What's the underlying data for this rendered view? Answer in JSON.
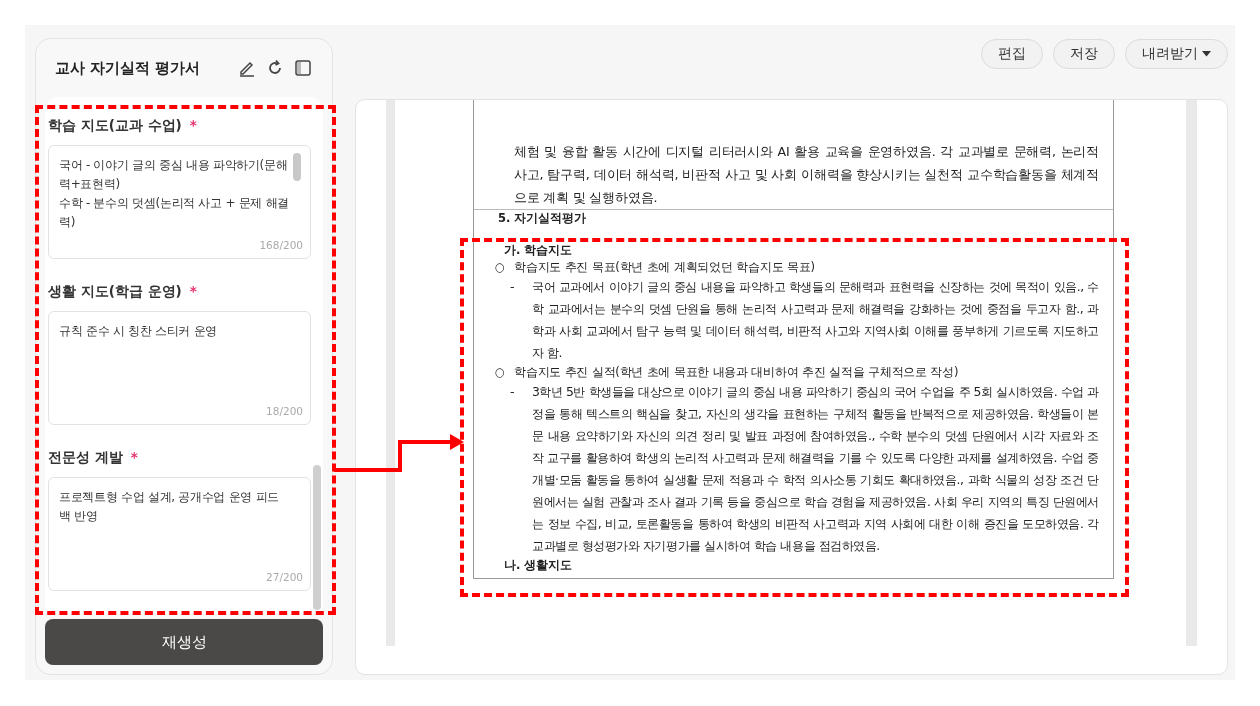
{
  "sidebar": {
    "title": "교사 자기실적 평가서",
    "fields": [
      {
        "label": "학습 지도(교과 수업)",
        "required_mark": "*",
        "value": "국어 - 이야기 글의 중심 내용 파악하기(문해력+표현력)\n수학 - 분수의 덧셈(논리적 사고 + 문제 해결력)",
        "count": "168/200",
        "scrollable": true
      },
      {
        "label": "생활 지도(학급 운영)",
        "required_mark": "*",
        "value": "규칙 준수 시 칭찬 스티커 운영",
        "count": "18/200",
        "scrollable": false
      },
      {
        "label": "전문성 계발",
        "required_mark": "*",
        "value": "프로젝트형 수업 설계, 공개수업 운영 피드백 반영",
        "count": "27/200",
        "scrollable": false
      }
    ],
    "regenerate_button": "재생성"
  },
  "toolbar": {
    "buttons": [
      {
        "label": "편집",
        "kind": "plain"
      },
      {
        "label": "저장",
        "kind": "plain"
      },
      {
        "label": "내려받기",
        "kind": "dropdown"
      }
    ]
  },
  "document": {
    "blocks": [
      {
        "kind": "continuation",
        "text": "체험 및 융합 활동 시간에 디지털 리터러시와 AI 활용 교육을 운영하였음. 각 교과별로 문해력, 논리적 사고, 탐구력, 데이터 해석력, 비판적 사고 및 사회 이해력을 향상시키는 실천적 교수학습활동을 체계적으로 계획 및 실행하였음."
      },
      {
        "kind": "section",
        "text": "5. 자기실적평가"
      },
      {
        "kind": "subheading",
        "text": "가. 학습지도"
      },
      {
        "kind": "bullet",
        "marker": "○",
        "text": "학습지도 추진 목표(학년 초에 계획되었던 학습지도 목표)"
      },
      {
        "kind": "dash",
        "marker": "-",
        "text": "국어 교과에서 이야기 글의 중심 내용을 파악하고 학생들의 문해력과 표현력을 신장하는 것에 목적이 있음., 수학 교과에서는 분수의 덧셈 단원을 통해 논리적 사고력과 문제 해결력을 강화하는 것에 중점을 두고자 함., 과학과 사회 교과에서 탐구 능력 및 데이터 해석력, 비판적 사고와 지역사회 이해를 풍부하게 기르도록 지도하고자 함."
      },
      {
        "kind": "bullet",
        "marker": "○",
        "text": "학습지도 추진 실적(학년 초에 목표한 내용과 대비하여 추진 실적을 구체적으로 작성)"
      },
      {
        "kind": "dash",
        "marker": "-",
        "text": "3학년 5반 학생들을 대상으로 이야기 글의 중심 내용 파악하기 중심의 국어 수업을 주 5회 실시하였음. 수업 과정을 통해 텍스트의 핵심을 찾고, 자신의 생각을 표현하는 구체적 활동을 반복적으로 제공하였음. 학생들이 본문 내용 요약하기와 자신의 의견 정리 및 발표 과정에 참여하였음., 수학 분수의 덧셈 단원에서 시각 자료와 조작 교구를 활용하여 학생의 논리적 사고력과 문제 해결력을 기를 수 있도록 다양한 과제를 설계하였음. 수업 중 개별·모둠 활동을 통하여 실생활 문제 적용과 수 학적 의사소통 기회도 확대하였음., 과학 식물의 성장 조건 단원에서는 실험 관찰과 조사 결과 기록 등을 중심으로 학습 경험을 제공하였음. 사회 우리 지역의 특징 단원에서는 정보 수집, 비교, 토론활동을 통하여 학생의 비판적 사고력과 지역 사회에 대한 이해 증진을 도모하였음. 각 교과별로 형성평가와 자기평가를 실시하여 학습 내용을 점검하였음."
      },
      {
        "kind": "subheading",
        "text": "나. 생활지도"
      }
    ]
  }
}
